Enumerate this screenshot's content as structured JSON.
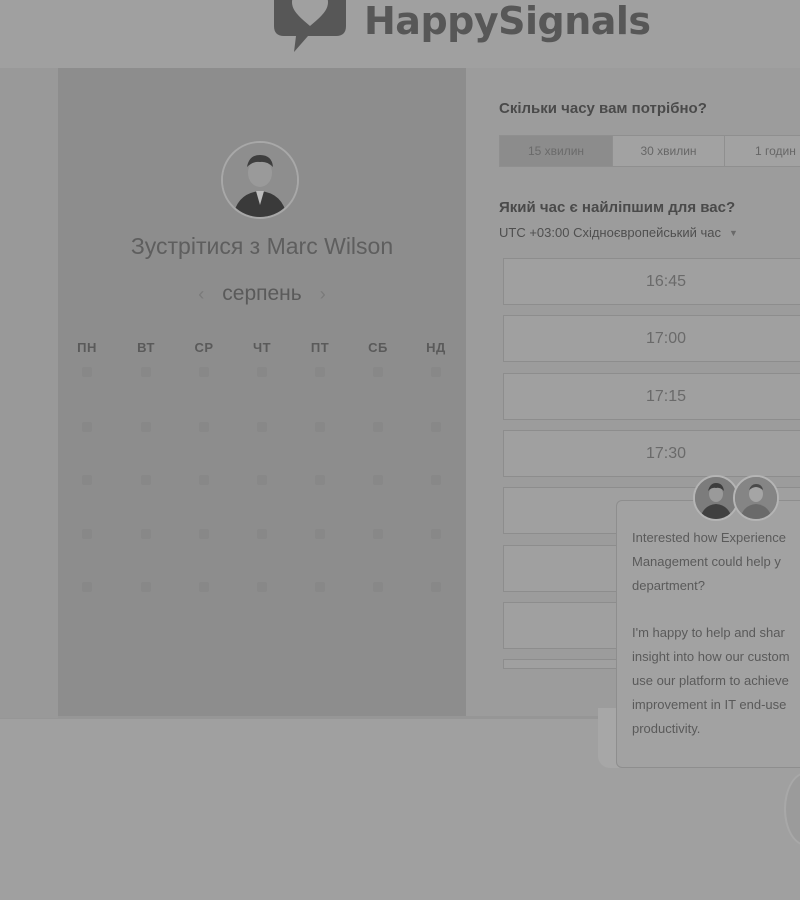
{
  "brand": {
    "name": "HappySignals"
  },
  "calendar": {
    "title": "Зустрітися з Marc Wilson",
    "month": "серпень",
    "prev_icon": "chevron-left-icon",
    "next_icon": "chevron-right-icon",
    "weekdays": [
      "ПН",
      "ВТ",
      "СР",
      "ЧТ",
      "ПТ",
      "СБ",
      "НД"
    ]
  },
  "booking": {
    "duration_question": "Скільки часу вам потрібно?",
    "durations": [
      "15 хвилин",
      "30 хвилин",
      "1 годин"
    ],
    "selected_duration": "15 хвилин",
    "time_question": "Який час є найліпшим для вас?",
    "timezone": "UTC +03:00 Східноєвропейський час",
    "slots": [
      "16:45",
      "17:00",
      "17:15",
      "17:30"
    ]
  },
  "chat": {
    "lines": [
      "Interested how Experience",
      "Management could help y",
      "department?",
      "",
      "I'm happy to help and shar",
      "insight into how our custom",
      "use our platform to achieve",
      "improvement in IT end-use",
      "productivity."
    ]
  }
}
